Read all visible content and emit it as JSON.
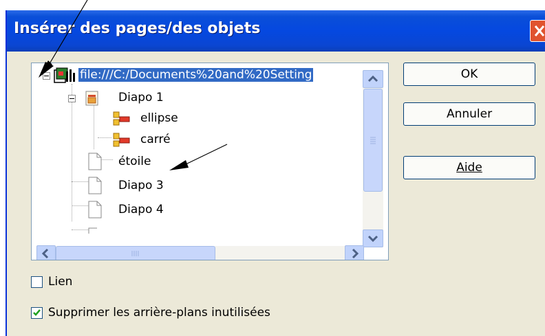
{
  "dialog": {
    "title": "Insérer des pages/des objets",
    "close_icon": "close-icon"
  },
  "tree": {
    "root": {
      "label": "file:///C:/Documents%20and%20Setting",
      "icon": "document-file-icon",
      "selected": true
    },
    "items": [
      {
        "label": "Diapo 1",
        "icon": "slide-icon"
      },
      {
        "label": "ellipse",
        "icon": "shape-object-icon"
      },
      {
        "label": "carré",
        "icon": "shape-object-icon"
      },
      {
        "label": "étoile",
        "icon": "page-icon"
      },
      {
        "label": "Diapo 3",
        "icon": "page-icon"
      },
      {
        "label": "Diapo 4",
        "icon": "page-icon"
      }
    ]
  },
  "buttons": {
    "ok": "OK",
    "cancel": "Annuler",
    "help": "Aide"
  },
  "options": {
    "link": {
      "label": "Lien",
      "checked": false
    },
    "delete_unused": {
      "label": "Supprimer les arrière-plans inutilisées",
      "checked": true
    }
  },
  "colors": {
    "titlebar": "#0548e0",
    "selection": "#316ac5",
    "dialog_bg": "#ece9d8",
    "close_button": "#e0532f"
  }
}
